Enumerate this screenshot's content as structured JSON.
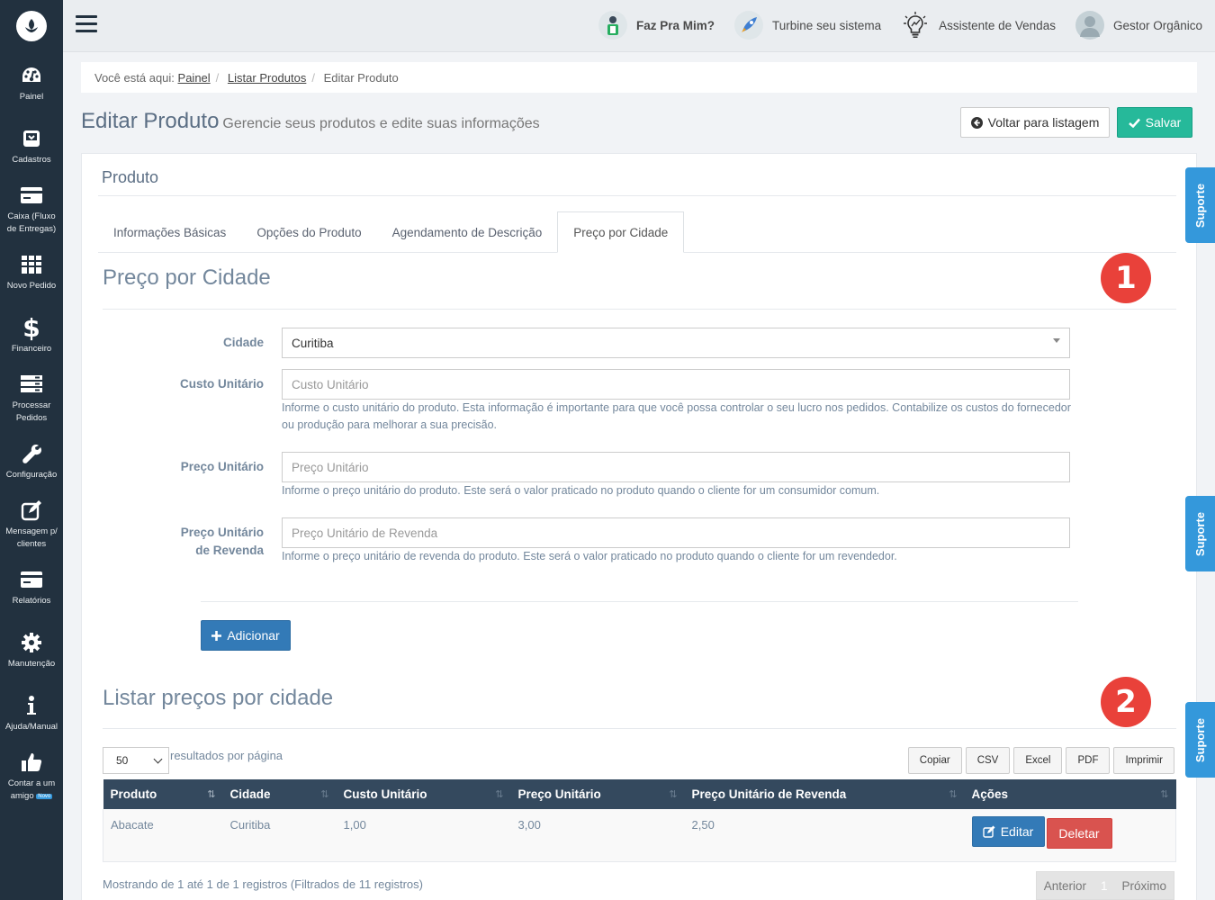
{
  "sidebar": {
    "items": [
      {
        "label": "Painel",
        "icon": "dashboard-icon"
      },
      {
        "label": "Cadastros",
        "icon": "box-icon"
      },
      {
        "label": "Caixa (Fluxo de Entregas)",
        "icon": "card-icon"
      },
      {
        "label": "Novo Pedido",
        "icon": "grid-icon"
      },
      {
        "label": "Financeiro",
        "icon": "dollar-icon"
      },
      {
        "label": "Processar Pedidos",
        "icon": "server-icon"
      },
      {
        "label": "Configuração",
        "icon": "wrench-icon"
      },
      {
        "label": "Mensagem p/ clientes",
        "icon": "edit-icon"
      },
      {
        "label": "Relatórios",
        "icon": "card-icon"
      },
      {
        "label": "Manutenção",
        "icon": "gear-icon"
      },
      {
        "label": "Ajuda/Manual",
        "icon": "info-icon"
      },
      {
        "label": "Contar a um amigo",
        "badge": "Novo",
        "icon": "thumbs-up-icon"
      }
    ]
  },
  "topbar": {
    "links": [
      "Faz Pra Mim?",
      "Turbine seu sistema",
      "Assistente de Vendas",
      "Gestor Orgânico"
    ]
  },
  "breadcrumb": {
    "prefix": "Você está aqui:",
    "items": [
      "Painel",
      "Listar Produtos",
      "Editar Produto"
    ]
  },
  "header": {
    "title": "Editar Produto",
    "subtitle": "Gerencie seus produtos e edite suas informações",
    "back_label": "Voltar para listagem",
    "save_label": "Salvar"
  },
  "panel": {
    "title": "Produto",
    "tabs": [
      "Informações Básicas",
      "Opções do Produto",
      "Agendamento de Descrição",
      "Preço por Cidade"
    ],
    "active_tab": "Preço por Cidade"
  },
  "form": {
    "section_title": "Preço por Cidade",
    "marker": "1",
    "city_label": "Cidade",
    "city_value": "Curitiba",
    "cost_label": "Custo Unitário",
    "cost_placeholder": "Custo Unitário",
    "cost_help": "Informe o custo unitário do produto. Esta informação é importante para que você possa controlar o seu lucro nos pedidos. Contabilize os custos do fornecedor ou produção para melhorar a sua precisão.",
    "price_label": "Preço Unitário",
    "price_placeholder": "Preço Unitário",
    "price_help": "Informe o preço unitário do produto. Este será o valor praticado no produto quando o cliente for um consumidor comum.",
    "resale_label": "Preço Unitário de Revenda",
    "resale_placeholder": "Preço Unitário de Revenda",
    "resale_help": "Informe o preço unitário de revenda do produto. Este será o valor praticado no produto quando o cliente for um revendedor.",
    "add_label": "Adicionar"
  },
  "list": {
    "section_title": "Listar preços por cidade",
    "marker": "2",
    "page_length": "50",
    "page_length_label": "resultados por página",
    "export_buttons": [
      "Copiar",
      "CSV",
      "Excel",
      "PDF",
      "Imprimir"
    ],
    "columns": [
      "Produto",
      "Cidade",
      "Custo Unitário",
      "Preço Unitário",
      "Preço Unitário de Revenda",
      "Ações"
    ],
    "rows": [
      {
        "produto": "Abacate",
        "cidade": "Curitiba",
        "custo": "1,00",
        "preco": "3,00",
        "revenda": "2,50"
      }
    ],
    "edit_label": "Editar",
    "delete_label": "Deletar",
    "info": "Mostrando de 1 até 1 de 1 registros (Filtrados de 11 registros)",
    "prev_label": "Anterior",
    "page_number": "1",
    "next_label": "Próximo"
  },
  "support": {
    "label": "Suporte"
  },
  "colors": {
    "sidebar": "#22313f",
    "save": "#26b99a",
    "primary": "#337ab7",
    "danger": "#d9534f",
    "marker": "#e9413a",
    "support": "#3498db",
    "table_header": "#34495e"
  }
}
